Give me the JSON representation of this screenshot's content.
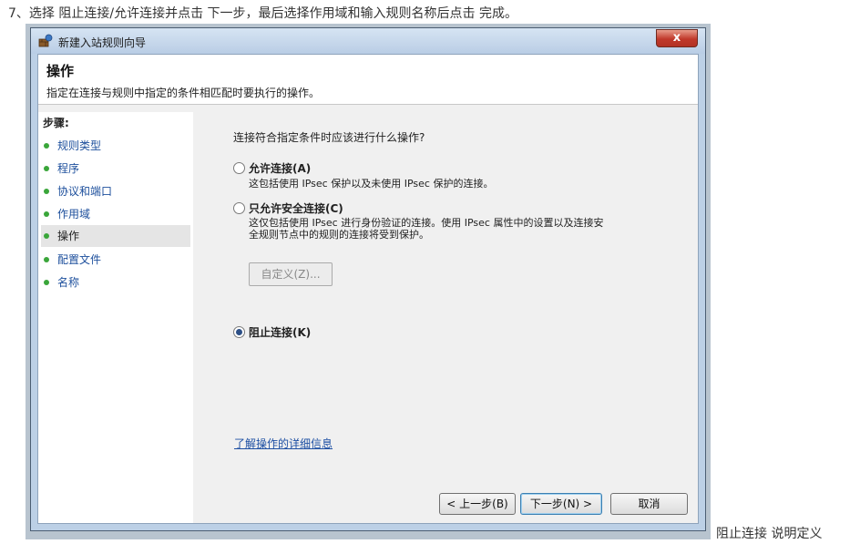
{
  "instruction": "7、选择 阻止连接/允许连接并点击 下一步，最后选择作用域和输入规则名称后点击 完成。",
  "caption": "阻止连接 说明定义",
  "window": {
    "title": "新建入站规则向导",
    "close_label": "x"
  },
  "header": {
    "title": "操作",
    "description": "指定在连接与规则中指定的条件相匹配时要执行的操作。"
  },
  "steps": {
    "title": "步骤:",
    "items": [
      {
        "label": "规则类型"
      },
      {
        "label": "程序"
      },
      {
        "label": "协议和端口"
      },
      {
        "label": "作用域"
      },
      {
        "label": "操作"
      },
      {
        "label": "配置文件"
      },
      {
        "label": "名称"
      }
    ]
  },
  "content": {
    "question": "连接符合指定条件时应该进行什么操作?",
    "options": [
      {
        "label": "允许连接(A)",
        "description": "这包括使用 IPsec 保护以及未使用 IPsec 保护的连接。",
        "checked": false
      },
      {
        "label": "只允许安全连接(C)",
        "description_line1": "这仅包括使用 IPsec 进行身份验证的连接。使用 IPsec 属性中的设置以及连接安",
        "description_line2": "全规则节点中的规则的连接将受到保护。",
        "checked": false
      },
      {
        "label": "阻止连接(K)",
        "checked": true
      }
    ],
    "customize_label": "自定义(Z)...",
    "learn_more": "了解操作的详细信息"
  },
  "buttons": {
    "back": "< 上一步(B)",
    "next": "下一步(N) >",
    "cancel": "取消"
  },
  "colors": {
    "step_bullet": "#3aa63a",
    "link": "#1d4fa3",
    "close_button": "#c0392b"
  }
}
